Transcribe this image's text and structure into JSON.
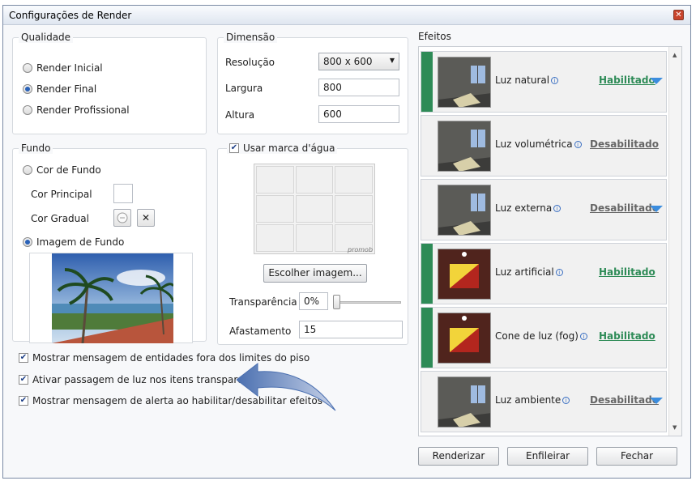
{
  "window": {
    "title": "Configurações de Render",
    "close_glyph": "✕"
  },
  "qualidade": {
    "label": "Qualidade",
    "options": [
      {
        "label": "Render Inicial",
        "selected": false
      },
      {
        "label": "Render Final",
        "selected": true
      },
      {
        "label": "Render Profissional",
        "selected": false
      }
    ]
  },
  "dimensao": {
    "label": "Dimensão",
    "resolucao_label": "Resolução",
    "resolucao_value": "800 x 600",
    "largura_label": "Largura",
    "largura_value": "800",
    "altura_label": "Altura",
    "altura_value": "600"
  },
  "fundo": {
    "label": "Fundo",
    "cor_fundo_label": "Cor de Fundo",
    "cor_principal_label": "Cor Principal",
    "cor_gradual_label": "Cor Gradual",
    "clear_glyph": "✕",
    "imagem_fundo_label": "Imagem de Fundo",
    "cor_fundo_selected": false,
    "imagem_fundo_selected": true
  },
  "marca": {
    "label": "Usar marca d'água",
    "checked": true,
    "watermark_text": "promob",
    "choose_button": "Escolher imagem...",
    "transparencia_label": "Transparência",
    "transparencia_value": "0%",
    "transparencia_level": 0,
    "afastamento_label": "Afastamento",
    "afastamento_value": "15"
  },
  "options": [
    {
      "label": "Mostrar mensagem de entidades fora dos limites do piso",
      "checked": true
    },
    {
      "label": "Ativar passagem de luz nos itens transparentes",
      "checked": true
    },
    {
      "label": "Mostrar mensagem de alerta ao habilitar/desabilitar efeitos",
      "checked": true
    }
  ],
  "efeitos": {
    "label": "Efeitos",
    "items": [
      {
        "name": "Luz natural",
        "status": "Habilitado",
        "enabled": true,
        "expand": true
      },
      {
        "name": "Luz volumétrica",
        "status": "Desabilitado",
        "enabled": false,
        "expand": false
      },
      {
        "name": "Luz externa",
        "status": "Desabilitado",
        "enabled": false,
        "expand": true
      },
      {
        "name": "Luz artificial",
        "status": "Habilitado",
        "enabled": true,
        "expand": false
      },
      {
        "name": "Cone de luz (fog)",
        "status": "Habilitado",
        "enabled": true,
        "expand": false
      },
      {
        "name": "Luz ambiente",
        "status": "Desabilitado",
        "enabled": false,
        "expand": true
      }
    ]
  },
  "buttons": {
    "renderizar": "Renderizar",
    "enfileirar": "Enfileirar",
    "fechar": "Fechar"
  },
  "colors": {
    "enabled_green": "#2e8b57",
    "accent_blue": "#3c8dde"
  }
}
